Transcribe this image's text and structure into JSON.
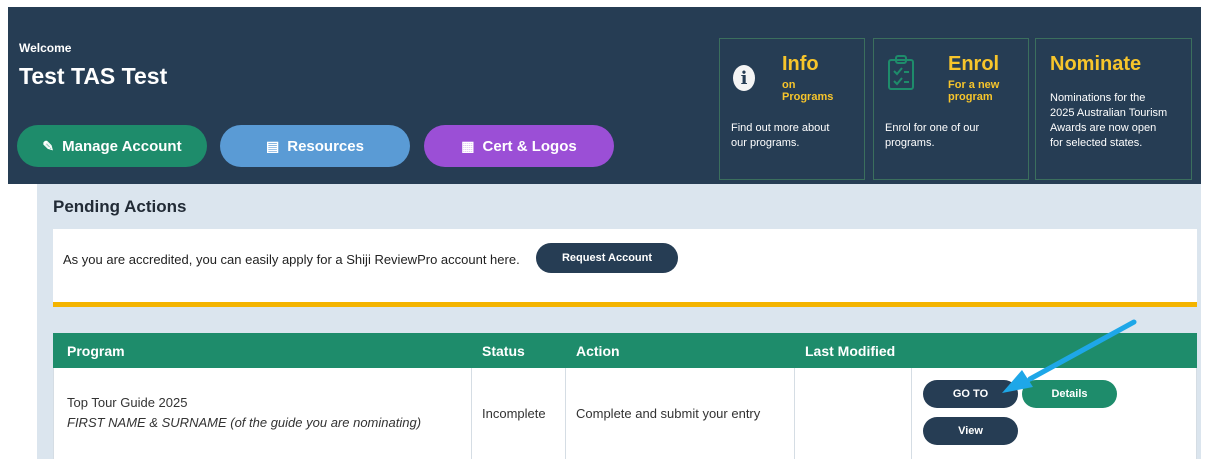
{
  "header": {
    "welcome": "Welcome",
    "user_name": "Test TAS Test",
    "buttons": [
      {
        "label": "Manage Account",
        "icon": "edit-icon",
        "color": "#1e8c6b"
      },
      {
        "label": "Resources",
        "icon": "document-icon",
        "color": "#5a9bd5"
      },
      {
        "label": "Cert & Logos",
        "icon": "certificate-icon",
        "color": "#9b4fd6"
      }
    ],
    "cards": {
      "info": {
        "title": "Info",
        "sub1": "on",
        "sub2": "Programs",
        "desc1": "Find out more about",
        "desc2": "our programs.",
        "icon": "info-icon"
      },
      "enrol": {
        "title": "Enrol",
        "sub1": "For a new",
        "sub2": "program",
        "desc1": "Enrol for one of our",
        "desc2": "programs.",
        "icon": "clipboard-icon"
      },
      "nominate": {
        "title": "Nominate",
        "desc1": "Nominations for the",
        "desc2": "2025 Australian Tourism",
        "desc3": "Awards are now open",
        "desc4": "for selected states."
      }
    }
  },
  "pending": {
    "title": "Pending Actions",
    "notice_text": "As you are accredited, you can easily apply for a Shiji ReviewPro account here.",
    "request_button": "Request Account"
  },
  "table": {
    "headers": {
      "program": "Program",
      "status": "Status",
      "action": "Action",
      "last_modified": "Last Modified"
    },
    "rows": [
      {
        "program": "Top Tour Guide 2025",
        "program_sub": "FIRST NAME & SURNAME (of the guide you are nominating)",
        "status": "Incomplete",
        "action": "Complete and submit your entry",
        "last_modified": "",
        "buttons": {
          "goto": "GO TO",
          "details": "Details",
          "view": "View"
        }
      }
    ]
  },
  "colors": {
    "header_bg": "#263d54",
    "accent_yellow": "#f7c52b",
    "table_header": "#1e8c6b",
    "arrow": "#1ea7e8"
  }
}
